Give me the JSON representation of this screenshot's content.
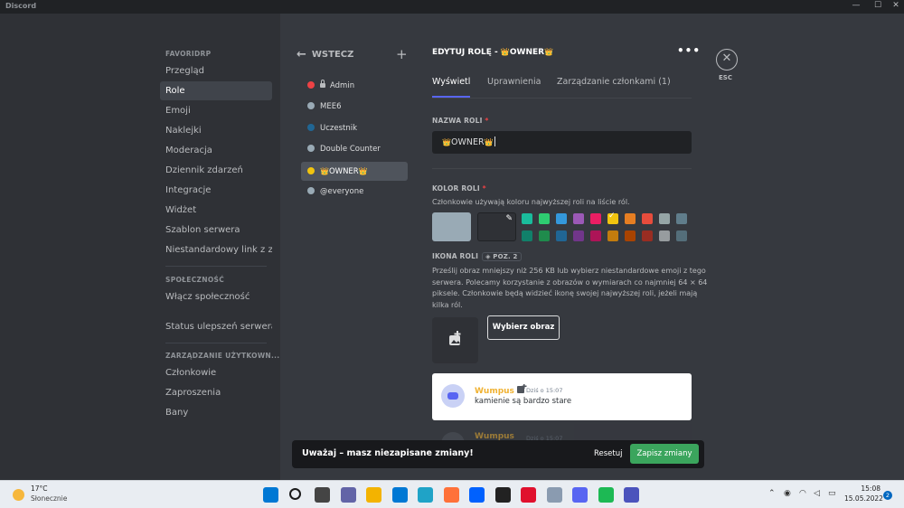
{
  "window": {
    "title": "Discord",
    "controls": [
      "—",
      "☐",
      "✕"
    ]
  },
  "sidebar": {
    "sections": [
      {
        "heading": "FAVORIDRP",
        "items": [
          "Przegląd",
          "Role",
          "Emoji",
          "Naklejki",
          "Moderacja",
          "Dziennik zdarzeń",
          "Integracje",
          "Widżet",
          "Szablon serwera",
          "Niestandardowy link z z..."
        ]
      },
      {
        "heading": "SPOŁECZNOŚĆ",
        "items": [
          "Włącz społeczność",
          "Status ulepszeń serwera"
        ]
      },
      {
        "heading": "ZARZĄDZANIE UŻYTKOWN...",
        "items": [
          "Członkowie",
          "Zaproszenia",
          "Bany"
        ]
      }
    ],
    "active": "Role"
  },
  "roles_panel": {
    "back_label": "WSTECZ",
    "add_icon": "+",
    "roles": [
      {
        "name": "Admin",
        "color": "#ed4245",
        "locked": true
      },
      {
        "name": "MEE6",
        "color": "#99aab5"
      },
      {
        "name": "Uczestnik",
        "color": "#206694"
      },
      {
        "name": "Double Counter",
        "color": "#99aab5"
      },
      {
        "name": "OWNER",
        "color": "#f1c40f",
        "crowned": true,
        "active": true
      },
      {
        "name": "@everyone",
        "color": "#99aab5"
      }
    ]
  },
  "editor": {
    "title_prefix": "EDYTUJ ROLĘ -",
    "role_name": "OWNER",
    "crown": "👑",
    "more": "•••",
    "tabs": [
      "Wyświetl",
      "Uprawnienia",
      "Zarządzanie członkami (1)"
    ],
    "active_tab": "Wyświetl",
    "name_label": "NAZWA ROLI",
    "required_mark": "*",
    "color_label": "KOLOR ROLI",
    "color_desc": "Członkowie używają koloru najwyższej roli na liście ról.",
    "default_color": "#99aab5",
    "selected_swatch": "#f1c40f",
    "swatches_row1": [
      "#1abc9c",
      "#2ecc71",
      "#3498db",
      "#9b59b6",
      "#e91e63",
      "#f1c40f",
      "#e67e22",
      "#e74c3c",
      "#95a5a6",
      "#607d8b"
    ],
    "swatches_row2": [
      "#11806a",
      "#1f8b4c",
      "#206694",
      "#71368a",
      "#ad1457",
      "#c27c0e",
      "#a84300",
      "#992d22",
      "#979c9f",
      "#546e7a"
    ],
    "icon_label": "IKONA ROLI",
    "icon_badge": "POZ. 2",
    "icon_desc_lines": [
      "Prześlij obraz mniejszy niż 256 KB lub wybierz niestandardowe emoji z tego",
      "serwera. Polecamy korzystanie z obrazów o wymiarach co najmniej 64 × 64",
      "piksele. Członkowie będą widzieć ikonę swojej najwyższej roli, jeżeli mają",
      "kilka ról."
    ],
    "choose_image": "Wybierz obraz",
    "esc_label": "ESC"
  },
  "preview": {
    "username": "Wumpus",
    "time": "Dziś o 15:07",
    "message": "kamienie są bardzo stare"
  },
  "unsaved_bar": {
    "message": "Uważaj – masz niezapisane zmiany!",
    "reset": "Resetuj",
    "save": "Zapisz zmiany"
  },
  "taskbar": {
    "weather_temp": "17°C",
    "weather_cond": "Słonecznie",
    "time": "15:08",
    "date": "15.05.2022",
    "notifications": "2",
    "apps": [
      {
        "name": "windows-start-icon",
        "color": "#0078d4"
      },
      {
        "name": "search-icon",
        "color": "#1a1a1a"
      },
      {
        "name": "task-view-icon",
        "color": "#444"
      },
      {
        "name": "teams-chat-icon",
        "color": "#6264a7"
      },
      {
        "name": "file-explorer-icon",
        "color": "#f3b300"
      },
      {
        "name": "mail-icon",
        "color": "#0078d4"
      },
      {
        "name": "edge-icon",
        "color": "#1fa3c7"
      },
      {
        "name": "firefox-icon",
        "color": "#ff7139"
      },
      {
        "name": "dropbox-icon",
        "color": "#0061fe"
      },
      {
        "name": "notion-icon",
        "color": "#222"
      },
      {
        "name": "opera-icon",
        "color": "#e0102d"
      },
      {
        "name": "snipping-icon",
        "color": "#8a9bb0"
      },
      {
        "name": "discord-icon",
        "color": "#5865f2"
      },
      {
        "name": "spotify-icon",
        "color": "#1db954"
      },
      {
        "name": "teams-icon",
        "color": "#4b53bc"
      }
    ]
  }
}
